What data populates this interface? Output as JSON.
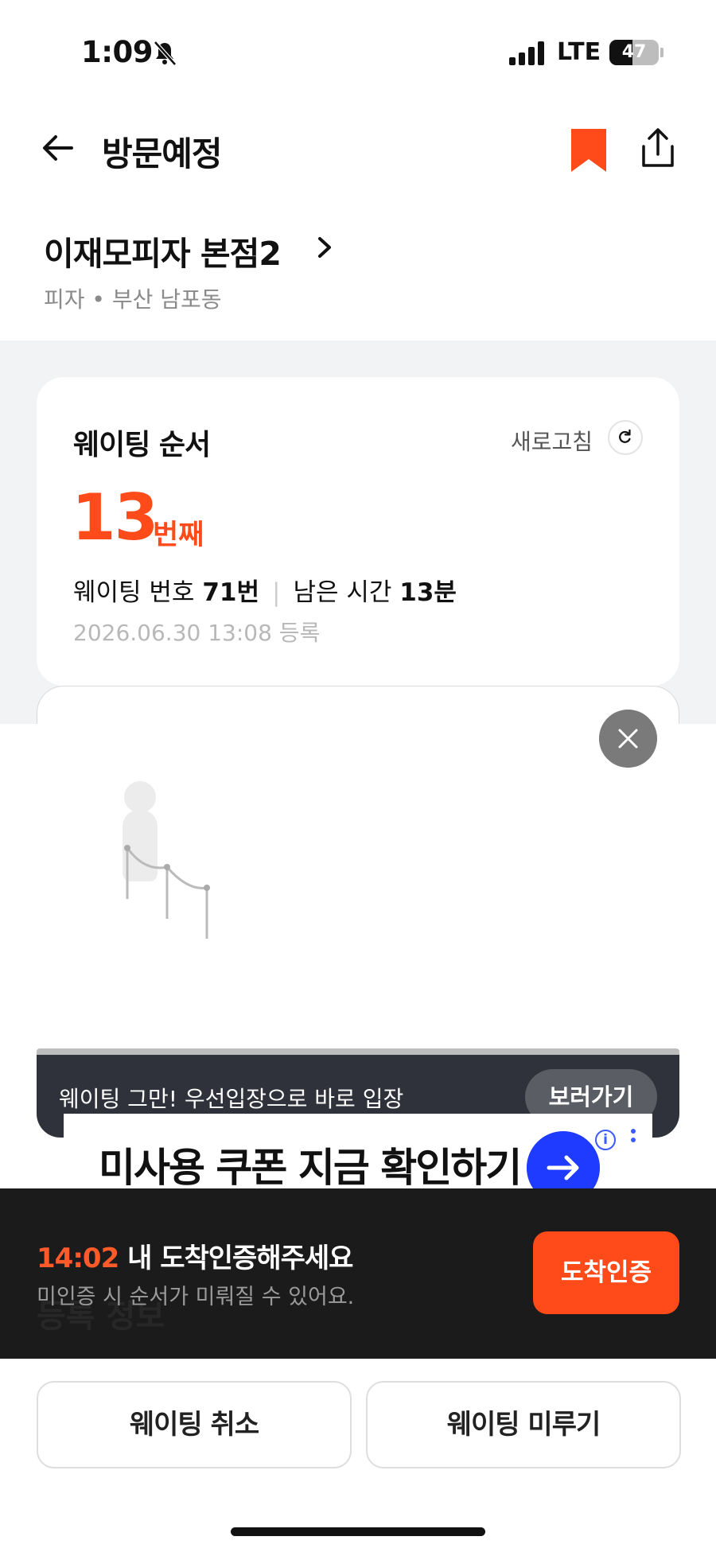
{
  "status_bar": {
    "time": "1:09",
    "network": "LTE",
    "battery": "47",
    "battery_level": 0.47
  },
  "header": {
    "title": "방문예정"
  },
  "shop": {
    "name": "이재모피자 본점2",
    "meta": "피자 • 부산 남포동"
  },
  "waiting_card": {
    "title": "웨이팅 순서",
    "refresh_label": "새로고침",
    "order": "13",
    "order_unit": "번째",
    "number_label": "웨이팅 번호",
    "number_value": "71번",
    "remaining_label": "남은 시간",
    "remaining_value": "13분",
    "registered": "2026.06.30 13:08 등록"
  },
  "banner": {
    "text": "웨이팅 그만! 우선입장으로 바로 입장",
    "button": "보러가기"
  },
  "ad": {
    "text": "미사용 쿠폰 지금 확인하기"
  },
  "arrival": {
    "time": "14:02",
    "title_suffix": "내 도착인증해주세요",
    "subtitle": "미인증 시 순서가 미뤄질 수 있어요.",
    "button": "도착인증",
    "behind_text": "등록 정보"
  },
  "actions": {
    "cancel": "웨이팅 취소",
    "delay": "웨이팅 미루기"
  },
  "colors": {
    "accent": "#ff4a1a",
    "dark_bar": "#1b1b1b",
    "ad_blue": "#1f3bff"
  }
}
